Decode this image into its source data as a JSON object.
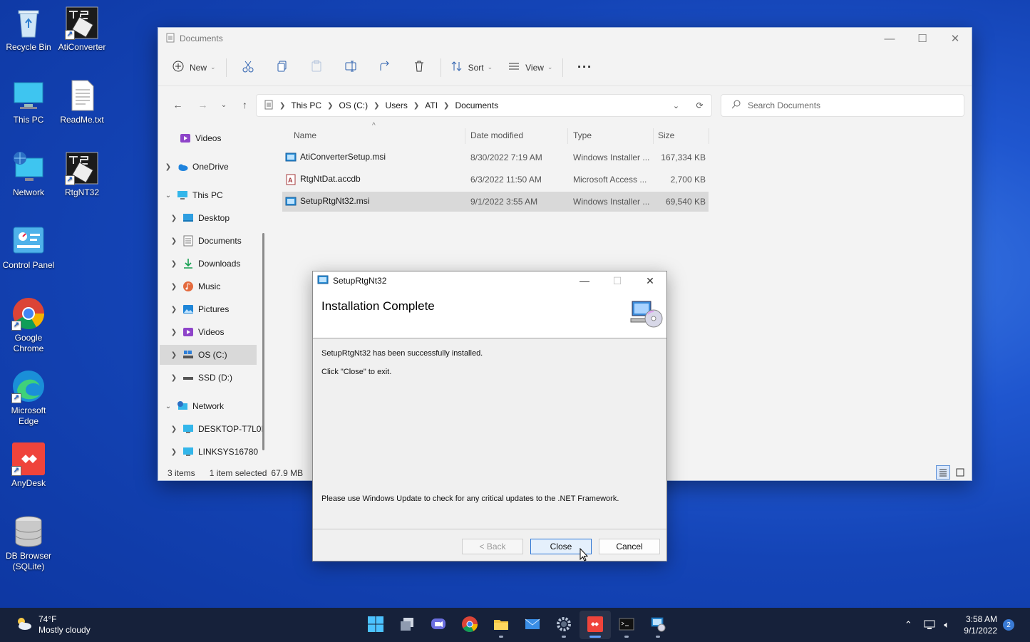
{
  "desktop": {
    "icons": [
      {
        "label": "Recycle Bin"
      },
      {
        "label": "AtiConverter"
      },
      {
        "label": "This PC"
      },
      {
        "label": "ReadMe.txt"
      },
      {
        "label": "Network"
      },
      {
        "label": "RtgNT32"
      },
      {
        "label": "Control Panel"
      },
      {
        "label": "Google Chrome"
      },
      {
        "label": "Microsoft Edge"
      },
      {
        "label": "AnyDesk"
      },
      {
        "label": "DB Browser (SQLite)"
      }
    ]
  },
  "explorer": {
    "title": "Documents",
    "toolbar": {
      "new_label": "New",
      "sort_label": "Sort",
      "view_label": "View"
    },
    "breadcrumb": [
      "This PC",
      "OS (C:)",
      "Users",
      "ATI",
      "Documents"
    ],
    "search_placeholder": "Search Documents",
    "nav": [
      {
        "label": "Videos"
      },
      {
        "label": "OneDrive"
      },
      {
        "label": "This PC"
      },
      {
        "label": "Desktop"
      },
      {
        "label": "Documents"
      },
      {
        "label": "Downloads"
      },
      {
        "label": "Music"
      },
      {
        "label": "Pictures"
      },
      {
        "label": "Videos"
      },
      {
        "label": "OS (C:)"
      },
      {
        "label": "SSD (D:)"
      },
      {
        "label": "Network"
      },
      {
        "label": "DESKTOP-T7L0I"
      },
      {
        "label": "LINKSYS16780"
      }
    ],
    "columns": {
      "name": "Name",
      "date": "Date modified",
      "type": "Type",
      "size": "Size"
    },
    "files": [
      {
        "name": "AtiConverterSetup.msi",
        "date": "8/30/2022 7:19 AM",
        "type": "Windows Installer ...",
        "size": "167,334 KB"
      },
      {
        "name": "RtgNtDat.accdb",
        "date": "6/3/2022 11:50 AM",
        "type": "Microsoft Access ...",
        "size": "2,700 KB"
      },
      {
        "name": "SetupRtgNt32.msi",
        "date": "9/1/2022 3:55 AM",
        "type": "Windows Installer ...",
        "size": "69,540 KB"
      }
    ],
    "status": {
      "count": "3 items",
      "selected": "1 item selected",
      "size": "67.9 MB"
    }
  },
  "dialog": {
    "title": "SetupRtgNt32",
    "heading": "Installation Complete",
    "line1": "SetupRtgNt32 has been successfully installed.",
    "line2": "Click \"Close\" to exit.",
    "line3": "Please use Windows Update to check for any critical updates to the .NET Framework.",
    "back_label": "< Back",
    "close_label": "Close",
    "cancel_label": "Cancel"
  },
  "taskbar": {
    "temperature": "74°F",
    "condition": "Mostly cloudy",
    "time": "3:58 AM",
    "date": "9/1/2022",
    "notification_count": "2"
  },
  "colors": {
    "accent": "#2b74d4",
    "taskbar": "#16213a",
    "selection": "#d9d9d9"
  }
}
